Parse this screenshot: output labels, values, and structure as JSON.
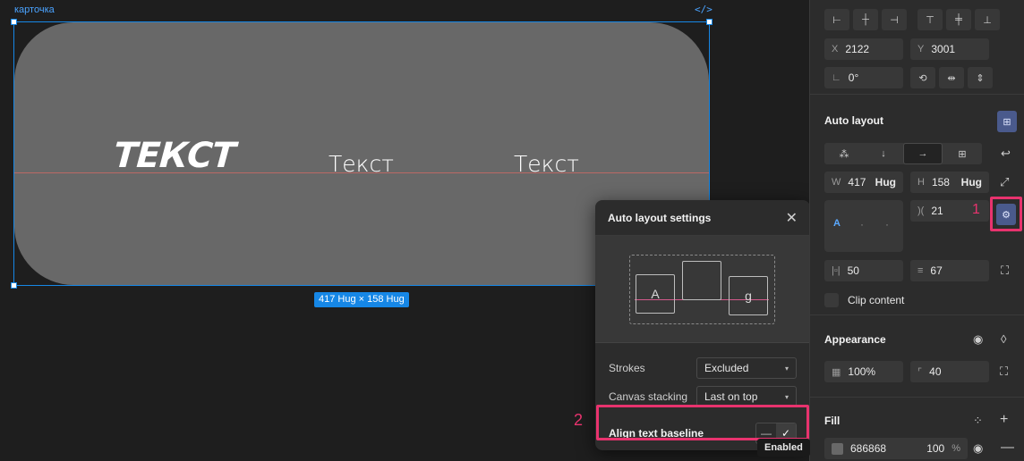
{
  "canvas": {
    "frame_label": "карточка",
    "code_icon": "</>",
    "texts": [
      "ТЕКСТ",
      "Текст",
      "Текст"
    ],
    "size_badge": "417 Hug × 158 Hug"
  },
  "popup": {
    "title": "Auto layout settings",
    "preview_letters": [
      "A",
      "g"
    ],
    "strokes_label": "Strokes",
    "strokes_value": "Excluded",
    "stacking_label": "Canvas stacking",
    "stacking_value": "Last on top",
    "baseline_label": "Align text baseline",
    "tooltip": "Enabled"
  },
  "annotations": {
    "marker1": "1",
    "marker2": "2"
  },
  "panel": {
    "position": {
      "x_label": "X",
      "x": "2122",
      "y_label": "Y",
      "y": "3001",
      "rotation": "0°"
    },
    "auto_layout": {
      "title": "Auto layout",
      "w_label": "W",
      "w": "417",
      "w_mode": "Hug",
      "h_label": "H",
      "h": "158",
      "h_mode": "Hug",
      "gap": "21",
      "align_letter": "A",
      "padding_h": "50",
      "padding_v": "67",
      "clip_label": "Clip content"
    },
    "appearance": {
      "title": "Appearance",
      "opacity": "100%",
      "radius": "40"
    },
    "fill": {
      "title": "Fill",
      "hex": "686868",
      "opacity": "100",
      "pct": "%"
    }
  },
  "colors": {
    "accent": "#1687e6",
    "highlight": "#e8336e",
    "fill": "#686868",
    "baseline": "#d76a64"
  }
}
